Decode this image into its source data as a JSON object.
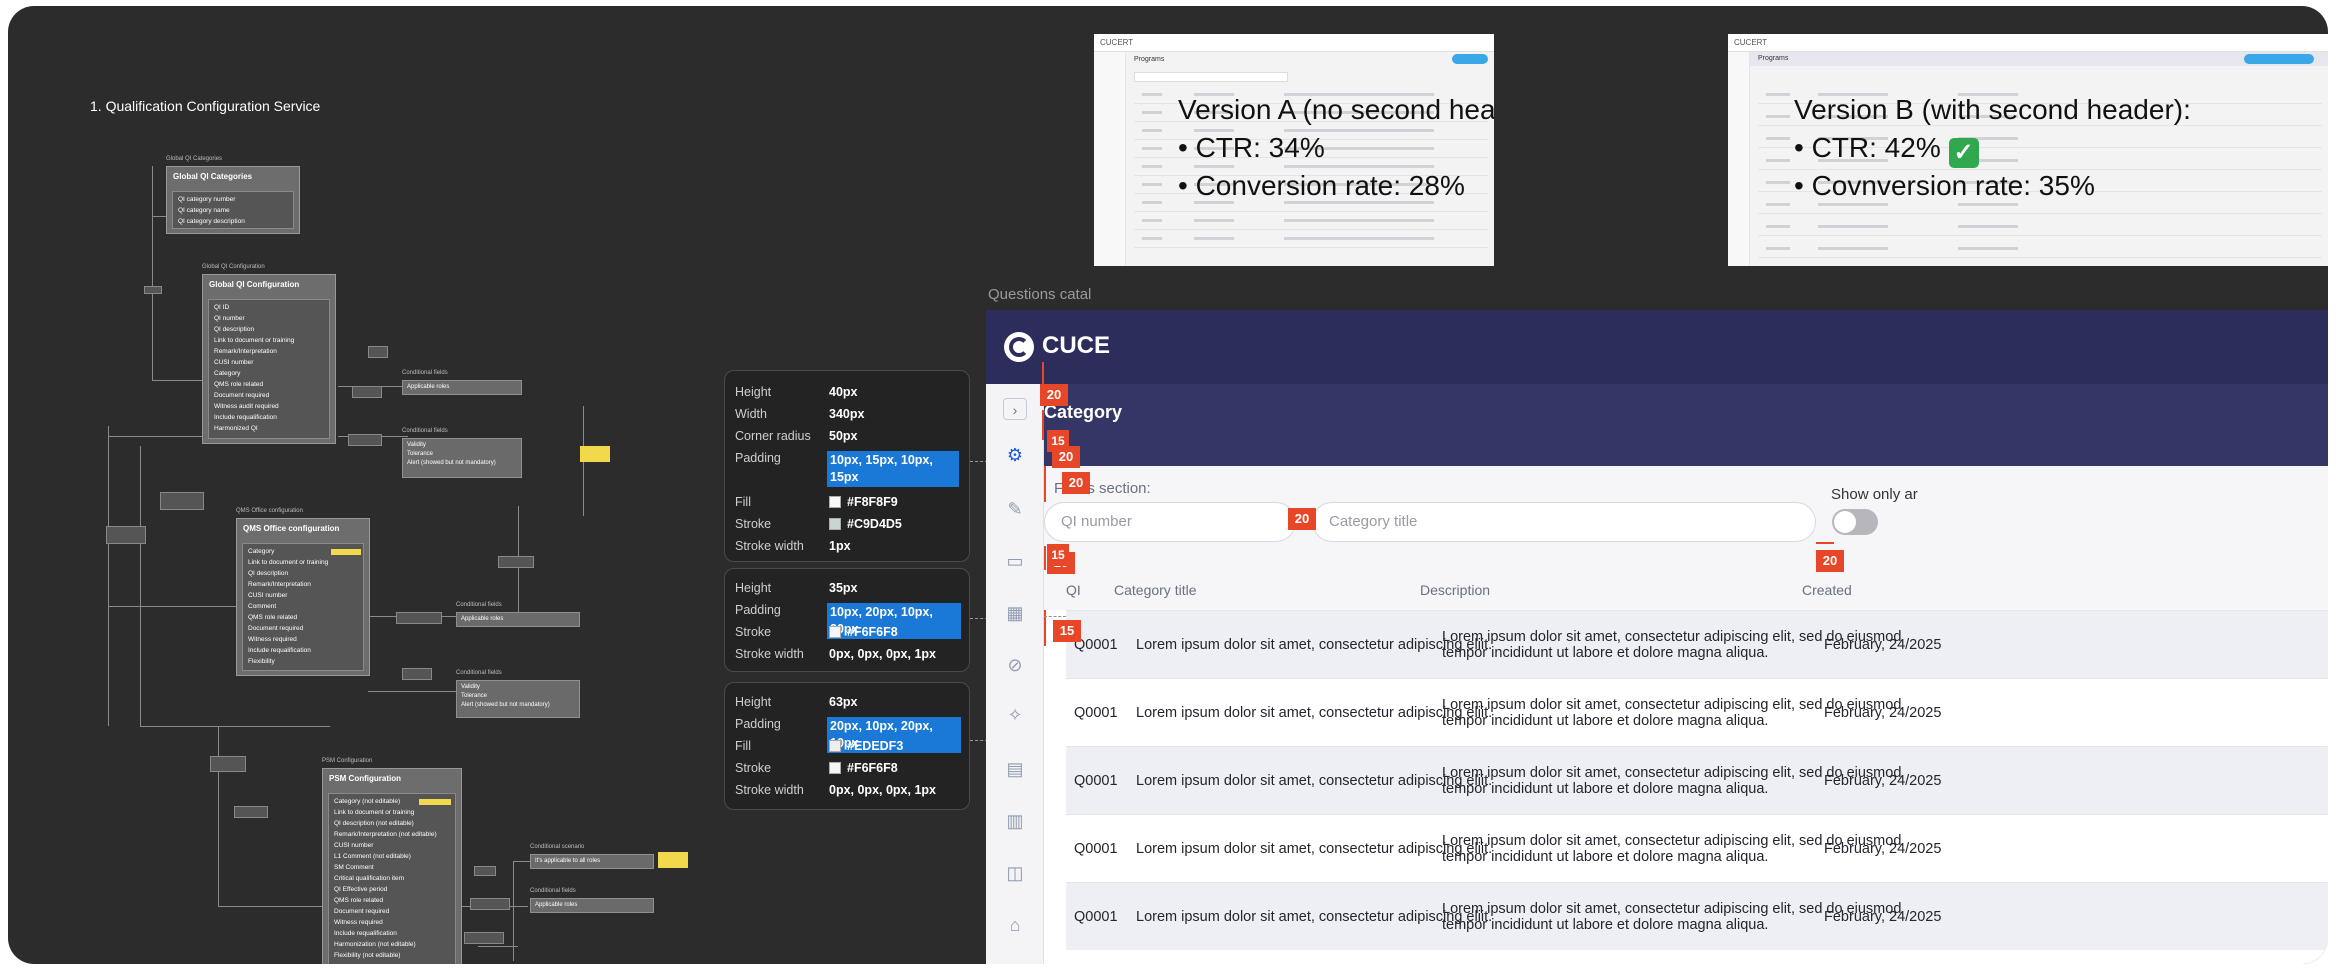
{
  "diagram": {
    "title": "1. Qualification Configuration Service",
    "global_categories": {
      "frame_label": "Global QI Categories",
      "title": "Global QI Categories",
      "fields": [
        "QI category number",
        "QI category name",
        "QI category description"
      ]
    },
    "global_config": {
      "frame_label": "Global QI Configuration",
      "title": "Global QI Configuration",
      "fields": [
        "QI ID",
        "QI number",
        "QI description",
        "Link to document or training",
        "Remark/Interpretation",
        "CUSI number",
        "Category",
        "QMS role related",
        "Document required",
        "Witness audit required",
        "Include requalification",
        "Harmonized QI"
      ]
    },
    "qms_office": {
      "frame_label": "QMS Office configuration",
      "title": "QMS Office configuration",
      "fields": [
        "Category",
        "Link to document or training",
        "QI description",
        "Remark/Interpretation",
        "CUSI number",
        "Comment",
        "QMS role related",
        "Document required",
        "Witness required",
        "Include requalification",
        "Flexibility"
      ]
    },
    "psm": {
      "frame_label": "PSM Configuration",
      "title": "PSM Configuration",
      "fields": [
        "Category (not editable)",
        "Link to document or training",
        "QI description (not editable)",
        "Remark/Interpretation (not editable)",
        "CUSI number",
        "L1 Comment (not editable)",
        "SM Comment",
        "Critical qualification item",
        "QI Effective period",
        "QMS role related",
        "Document required",
        "Witness required",
        "Include requalification",
        "Harmonization (not editable)",
        "Flexibility (not editable)"
      ]
    },
    "conditional_fields_label": "Conditional fields",
    "applicable_roles": "Applicable roles",
    "validity_group": [
      "Validity",
      "Tolerance",
      "Alert (showed but not mandatory)"
    ],
    "conditional_scenario_label": "Conditional scenario",
    "applicable_all_roles": "It's applicable to all roles"
  },
  "spec_cards": [
    {
      "rows": [
        {
          "key": "Height",
          "value": "40px"
        },
        {
          "key": "Width",
          "value": "340px"
        },
        {
          "key": "Corner radius",
          "value": "50px"
        },
        {
          "key": "Padding",
          "value": "10px, 15px, 10px, 15px",
          "highlight": true
        },
        {
          "key": "Fill",
          "value": "#F8F8F9",
          "swatch": "#F8F8F9"
        },
        {
          "key": "Stroke",
          "value": "#C9D4D5",
          "swatch": "#C9D4D5"
        },
        {
          "key": "Stroke width",
          "value": "1px"
        }
      ]
    },
    {
      "rows": [
        {
          "key": "Height",
          "value": "35px"
        },
        {
          "key": "Padding",
          "value": "10px, 20px, 10px, 20px",
          "highlight": true
        },
        {
          "key": "Stroke",
          "value": "#F6F6F8",
          "swatch": "#F6F6F8"
        },
        {
          "key": "Stroke width",
          "value": "0px, 0px, 0px, 1px"
        }
      ]
    },
    {
      "rows": [
        {
          "key": "Height",
          "value": "63px"
        },
        {
          "key": "Padding",
          "value": "20px, 10px, 20px, 10px",
          "highlight": true
        },
        {
          "key": "Fill",
          "value": "#EDEDF3",
          "swatch": "#EDEDF3"
        },
        {
          "key": "Stroke",
          "value": "#F6F6F8",
          "swatch": "#F6F6F8"
        },
        {
          "key": "Stroke width",
          "value": "0px, 0px, 0px, 1px"
        }
      ]
    }
  ],
  "app": {
    "frame_label": "Questions catal",
    "logo_text": "CUCE",
    "page_title": "Category",
    "filters_label": "Filters section:",
    "qi_placeholder": "QI number",
    "category_placeholder": "Category title",
    "show_only_label": "Show only ar",
    "columns": [
      "QI",
      "Category title",
      "Description",
      "Created"
    ],
    "rows": [
      {
        "qi": "Q0001",
        "title": "Lorem ipsum dolor sit amet, consectetur adipiscing eliit.",
        "desc1": "Lorem ipsum dolor sit amet, consectetur adipiscing elit, sed do eiusmod",
        "desc2": "tempor incididunt ut labore et dolore magna aliqua.",
        "created": "February, 24/2025"
      },
      {
        "qi": "Q0001",
        "title": "Lorem ipsum dolor sit amet, consectetur adipiscing eliit.",
        "desc1": "Lorem ipsum dolor sit amet, consectetur adipiscing elit, sed do eiusmod",
        "desc2": "tempor incididunt ut labore et dolore magna aliqua.",
        "created": "February, 24/2025"
      },
      {
        "qi": "Q0001",
        "title": "Lorem ipsum dolor sit amet, consectetur adipiscing eliit.",
        "desc1": "Lorem ipsum dolor sit amet, consectetur adipiscing elit, sed do eiusmod",
        "desc2": "tempor incididunt ut labore et dolore magna aliqua.",
        "created": "February, 24/2025"
      },
      {
        "qi": "Q0001",
        "title": "Lorem ipsum dolor sit amet, consectetur adipiscing eliit.",
        "desc1": "Lorem ipsum dolor sit amet, consectetur adipiscing elit, sed do eiusmod",
        "desc2": "tempor incididunt ut labore et dolore magna aliqua.",
        "created": "February, 24/2025"
      },
      {
        "qi": "Q0001",
        "title": "Lorem ipsum dolor sit amet, consectetur adipiscing eliit.",
        "desc1": "Lorem ipsum dolor sit amet, consectetur adipiscing elit, sed do eiusmod",
        "desc2": "tempor incididunt ut labore et dolore magna aliqua.",
        "created": "February, 24/2025"
      }
    ],
    "spacing_badges": [
      "20",
      "15",
      "20",
      "20",
      "20",
      "15",
      "20",
      "15",
      "20"
    ]
  },
  "version_a": {
    "logo": "CUCERT",
    "page": "Programs",
    "heading": "Version A (no second header):",
    "line1": "• CTR: 34%",
    "line2": "• Conversion rate: 28%"
  },
  "version_b": {
    "logo": "CUCERT",
    "page": "Programs",
    "heading": "Version B (with second header):",
    "line1": "• CTR: 42%",
    "line2": "• Covnversion rate: 35%"
  },
  "icons": {
    "logo": "logo-c-icon",
    "chevron": "chevron-right-icon",
    "check": "check-mark-icon"
  },
  "colors": {
    "canvas": "#2c2c2c",
    "header": "#2c2d5a",
    "category_band": "#343766",
    "badge": "#e84628",
    "highlight": "#1a78d6",
    "row_alt": "#eeeef5"
  }
}
